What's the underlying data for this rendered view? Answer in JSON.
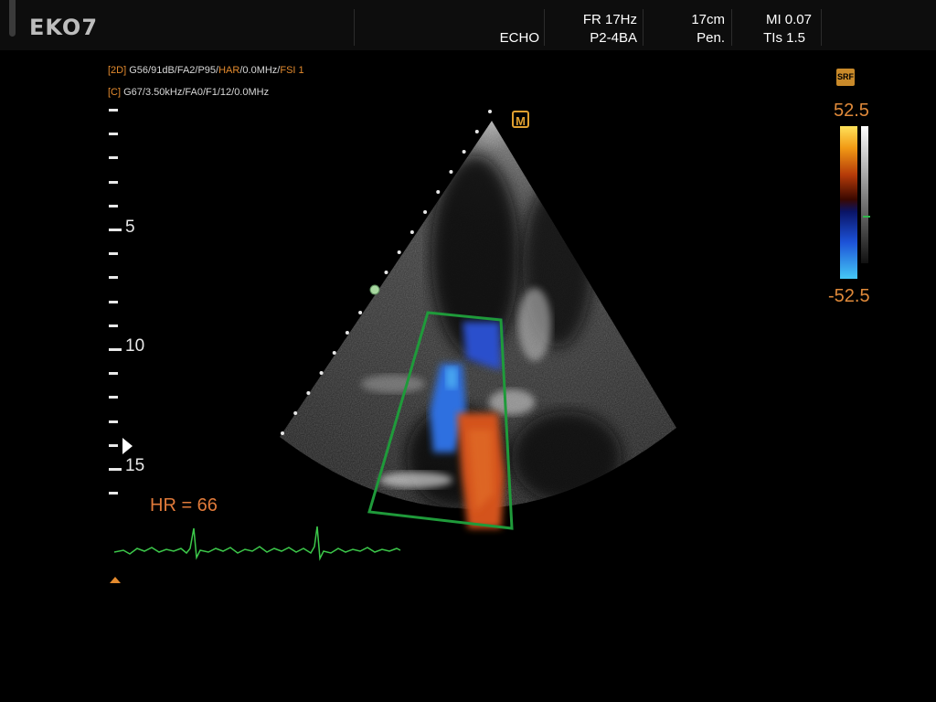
{
  "header": {
    "brand": "EKO7",
    "mode": "ECHO",
    "frame_rate": "FR 17Hz",
    "preset": "P2-4BA",
    "depth": "17cm",
    "penetration": "Pen.",
    "mi": "MI 0.07",
    "tis": "TIs 1.5"
  },
  "params": {
    "line_2d_tag": "[2D]",
    "line_2d_text": "G56/91dB/FA2/P95/",
    "line_2d_har": "HAR",
    "line_2d_mhz": "/0.0MHz/",
    "line_2d_fsi": "FSI 1",
    "line_c_tag": "[C]",
    "line_c_text": "G67/3.50kHz/FA0/F1/12/0.0MHz"
  },
  "depth_scale": {
    "labels": [
      "5",
      "10",
      "15"
    ],
    "unit_ticks": 17
  },
  "heart_rate": "HR = 66",
  "icons": {
    "m_icon": "M",
    "srf_badge": "SRF"
  },
  "color_scale": {
    "max": "52.5",
    "min": "-52.5"
  },
  "colors": {
    "accent_orange": "#e38a2e",
    "roi_box_green": "#1f9a3a",
    "ecg_green": "#3cc84a",
    "doppler_red": "#d04a1a",
    "doppler_blue": "#2a55d8"
  }
}
